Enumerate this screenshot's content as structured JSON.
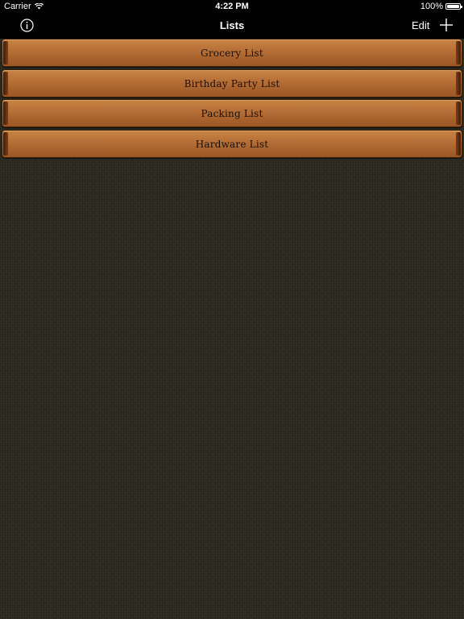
{
  "status_bar": {
    "carrier": "Carrier",
    "time": "4:22 PM",
    "battery": "100%"
  },
  "nav": {
    "title": "Lists",
    "edit_label": "Edit",
    "info_icon": "info-icon",
    "add_icon": "plus-icon"
  },
  "lists": [
    {
      "label": "Grocery List"
    },
    {
      "label": "Birthday Party List"
    },
    {
      "label": "Packing List"
    },
    {
      "label": "Hardware List"
    }
  ],
  "colors": {
    "row_wood": "#b9733a",
    "row_edge": "#4a230a",
    "background_linen": "#2a2a20"
  }
}
